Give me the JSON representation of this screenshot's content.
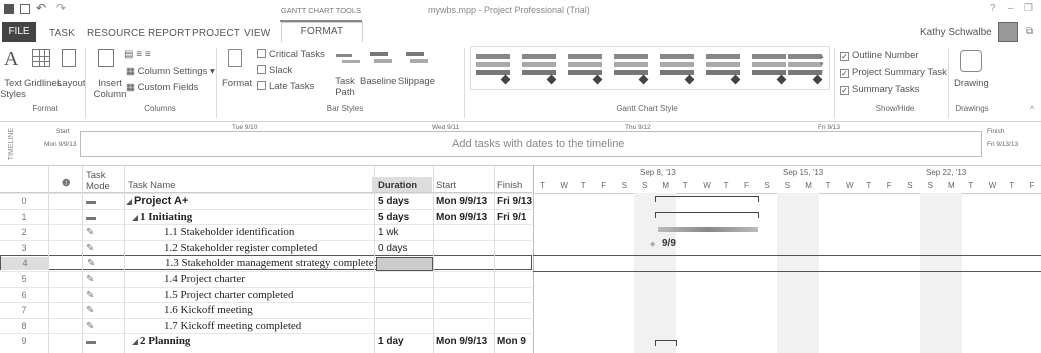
{
  "titlebar": {
    "context_tab": "GANTT CHART TOOLS",
    "title": "mywbs.mpp - Project Professional (Trial)",
    "user": "Kathy Schwalbe",
    "help": "?"
  },
  "tabs": [
    "FILE",
    "TASK",
    "RESOURCE",
    "REPORT",
    "PROJECT",
    "VIEW",
    "FORMAT"
  ],
  "ribbon": {
    "text_styles": "Text Styles",
    "gridlines": "Gridlines",
    "layout": "Layout",
    "insert_column": "Insert Column",
    "column_settings": "Column Settings",
    "custom_fields": "Custom Fields",
    "format": "Format",
    "critical_tasks": "Critical Tasks",
    "slack": "Slack",
    "late_tasks": "Late Tasks",
    "task_path": "Task Path",
    "baseline": "Baseline",
    "slippage": "Slippage",
    "outline_number": "Outline Number",
    "project_summary_task": "Project Summary Task",
    "summary_tasks": "Summary Tasks",
    "drawing": "Drawing",
    "groups": {
      "format": "Format",
      "columns": "Columns",
      "bar_styles": "Bar Styles",
      "gantt_chart_style": "Gantt Chart Style",
      "show_hide": "Show/Hide",
      "drawings": "Drawings"
    },
    "checks": {
      "outline_number": true,
      "project_summary_task": true,
      "summary_tasks": true,
      "critical_tasks": false,
      "slack": false,
      "late_tasks": false
    }
  },
  "timeline": {
    "side_label": "TIMELINE",
    "start_label": "Start",
    "start_date": "Mon 9/9/13",
    "finish_label": "Finish",
    "finish_date": "Fri 9/13/13",
    "ticks": [
      "Tue 9/10",
      "Wed 9/11",
      "Thu 9/12",
      "Fri 9/13"
    ],
    "placeholder": "Add tasks with dates to the timeline"
  },
  "grid": {
    "headers": {
      "info": "i",
      "mode": "Task Mode",
      "name": "Task Name",
      "duration": "Duration",
      "start": "Start",
      "finish": "Finish"
    },
    "rows": [
      {
        "id": "0",
        "name": "Project A+",
        "duration": "5 days",
        "start": "Mon 9/9/13",
        "finish": "Fri 9/13",
        "bold": true,
        "mode": "auto"
      },
      {
        "id": "1",
        "name": "1 Initiating",
        "duration": "5 days",
        "start": "Mon 9/9/13",
        "finish": "Fri 9/1",
        "bold": true,
        "mode": "auto"
      },
      {
        "id": "2",
        "name": "1.1 Stakeholder identification",
        "duration": "1 wk",
        "start": "",
        "finish": "",
        "bold": false,
        "mode": "manual"
      },
      {
        "id": "3",
        "name": "1.2 Stakeholder register completed",
        "duration": "0 days",
        "start": "",
        "finish": "",
        "bold": false,
        "mode": "manual"
      },
      {
        "id": "4",
        "name": "1.3 Stakeholder management strategy completed",
        "duration": "",
        "start": "",
        "finish": "",
        "bold": false,
        "mode": "manual"
      },
      {
        "id": "5",
        "name": "1.4 Project charter",
        "duration": "",
        "start": "",
        "finish": "",
        "bold": false,
        "mode": "manual"
      },
      {
        "id": "6",
        "name": "1.5 Project charter completed",
        "duration": "",
        "start": "",
        "finish": "",
        "bold": false,
        "mode": "manual"
      },
      {
        "id": "7",
        "name": "1.6 Kickoff meeting",
        "duration": "",
        "start": "",
        "finish": "",
        "bold": false,
        "mode": "manual"
      },
      {
        "id": "8",
        "name": "1.7 Kickoff meeting completed",
        "duration": "",
        "start": "",
        "finish": "",
        "bold": false,
        "mode": "manual"
      },
      {
        "id": "9",
        "name": "2 Planning",
        "duration": "1 day",
        "start": "Mon 9/9/13",
        "finish": "Mon 9",
        "bold": true,
        "mode": "auto"
      }
    ]
  },
  "gantt": {
    "weeks": [
      "Sep 8, '13",
      "Sep 15, '13",
      "Sep 22, '13"
    ],
    "days": [
      "T",
      "W",
      "T",
      "F",
      "S",
      "S",
      "M",
      "T",
      "W",
      "T",
      "F",
      "S",
      "S",
      "M",
      "T",
      "W",
      "T",
      "F",
      "S",
      "S",
      "M",
      "T",
      "W",
      "T",
      "F"
    ],
    "milestone_label": "9/9"
  }
}
